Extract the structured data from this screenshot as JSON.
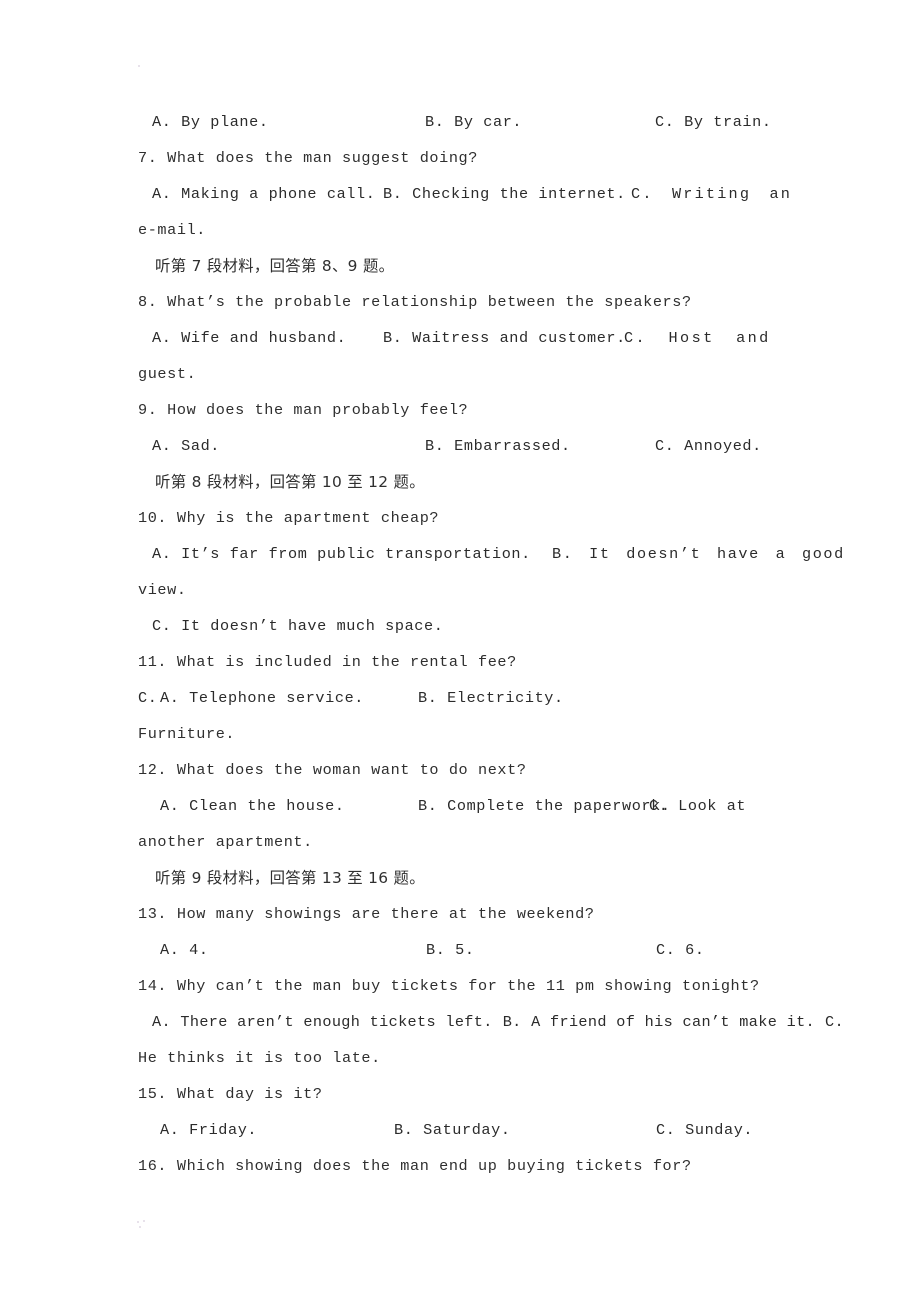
{
  "document": {
    "type": "english-listening-comprehension-worksheet",
    "language_note": "bilingual Chinese/English exam paper"
  },
  "lines": {
    "q6_options": {
      "a": "A. By plane.",
      "b": "B. By car.",
      "c": "C. By train."
    },
    "q7_stem": "7. What does the man suggest doing?",
    "q7_options": {
      "a": "A. Making a phone call.",
      "b": "B. Checking the internet.",
      "c": "C.  Writing  an"
    },
    "q7_wrap": "e-mail.",
    "cn_section_7": "听第 7 段材料，回答第 8、9 题。",
    "q8_stem": "8. What’s the probable relationship between the speakers?",
    "q8_options": {
      "a": "A. Wife and husband.",
      "b": "B. Waitress and customer.",
      "c": "C.   Host   and"
    },
    "q8_wrap": "guest.",
    "q9_stem": "9. How does the man probably feel?",
    "q9_options": {
      "a": "A. Sad.",
      "b": "B. Embarrassed.",
      "c": "C. Annoyed."
    },
    "cn_section_8": "听第 8 段材料，回答第 10 至 12 题。",
    "q10_stem": "10. Why is the apartment cheap?",
    "q10_options": {
      "a": "A. It’s far from public transportation.",
      "b": "B.  It  doesn’t  have  a  good",
      "c": "C. It doesn’t have much space."
    },
    "q10_wrap": "view.",
    "q11_stem": "11. What is included in the rental fee?",
    "q11_options": {
      "a": "A. Telephone service.",
      "b": "B. Electricity.",
      "c": "C."
    },
    "q11_wrap": "Furniture.",
    "q12_stem": "12. What does the woman want to do next?",
    "q12_options": {
      "a": "A. Clean the house.",
      "b": "B. Complete the paperwork.",
      "c": "C.  Look  at"
    },
    "q12_wrap": "another apartment.",
    "cn_section_9": "听第 9 段材料，回答第 13 至 16 题。",
    "q13_stem": "13. How many showings are there at the weekend?",
    "q13_options": {
      "a": "A. 4.",
      "b": "B. 5.",
      "c": "C. 6."
    },
    "q14_stem": "14. Why can’t the man buy tickets for the 11 pm showing tonight?",
    "q14_options_inline": {
      "a": "A. There aren’t enough tickets left.",
      "b": "B. A friend of his can’t make it.",
      "c": "C."
    },
    "q14_wrap": "He thinks it is too late.",
    "q15_stem": "15. What day is it?",
    "q15_options": {
      "a": "A. Friday.",
      "b": "B. Saturday.",
      "c": "C. Sunday."
    },
    "q16_stem": "16. Which showing does the man end up buying tickets for?"
  }
}
